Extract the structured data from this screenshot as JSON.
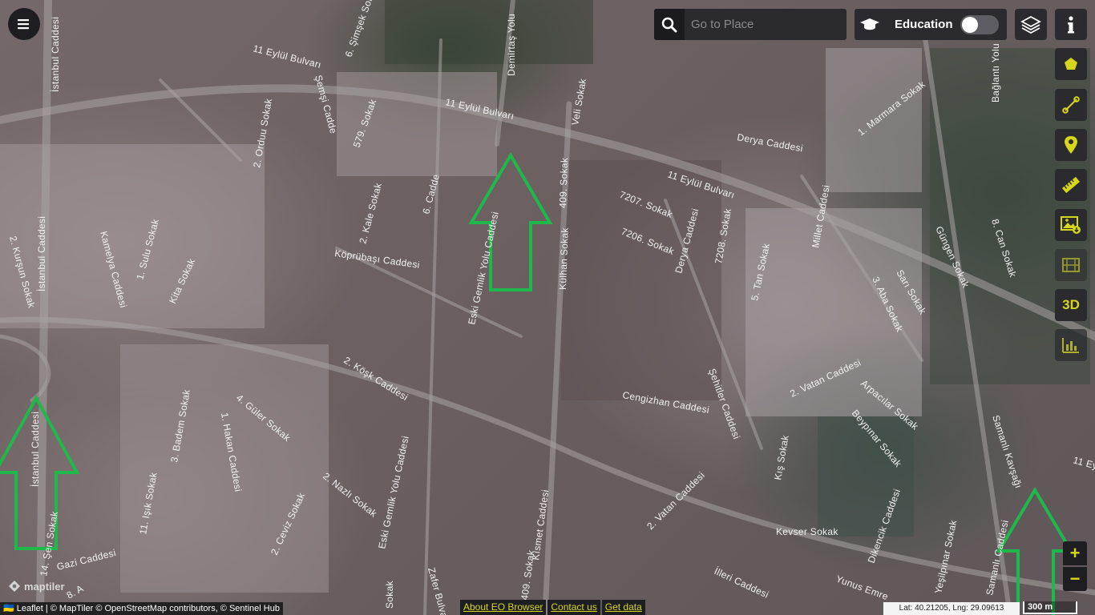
{
  "search": {
    "placeholder": "Go to Place"
  },
  "education": {
    "label": "Education",
    "enabled": false
  },
  "side_buttons": [
    {
      "icon": "polygon-icon"
    },
    {
      "icon": "line-measure-icon"
    },
    {
      "icon": "map-pin-icon"
    },
    {
      "icon": "ruler-icon"
    },
    {
      "icon": "image-download-icon"
    },
    {
      "icon": "film-icon"
    },
    {
      "icon": "3d-label",
      "label": "3D"
    },
    {
      "icon": "bar-chart-icon"
    }
  ],
  "zoom": {
    "in": "+",
    "out": "−"
  },
  "logo": {
    "text": "maptiler"
  },
  "attribution": "🇺🇦 Leaflet | © MapTiler © OpenStreetMap contributors, © Sentinel Hub",
  "footer_links": [
    "About EO Browser",
    "Contact us",
    "Get data"
  ],
  "coords": "Lat: 40.21205, Lng: 29.09613",
  "scale": "300 m",
  "road_labels": [
    {
      "text": "İstanbul Caddesi"
    },
    {
      "text": "11 Eylül Bulvarı"
    },
    {
      "text": "6. Şimşek Sokak"
    },
    {
      "text": "Demirtaş Yolu"
    },
    {
      "text": "Veli Sokak"
    },
    {
      "text": "11 Eylül Bulvarı"
    },
    {
      "text": "11 Eylül Bulvarı"
    },
    {
      "text": "Derya Caddesi"
    },
    {
      "text": "1. Marmara Sokak"
    },
    {
      "text": "Bağlantı Yolu"
    },
    {
      "text": "2. Orduu Sokak"
    },
    {
      "text": "Şemşi Cadde"
    },
    {
      "text": "579. Sokak"
    },
    {
      "text": "7207. Sokak"
    },
    {
      "text": "7206. Sokak"
    },
    {
      "text": "7208. Sokak"
    },
    {
      "text": "Derya Caddesi"
    },
    {
      "text": "Millet Caddesi"
    },
    {
      "text": "Güngen Sokak"
    },
    {
      "text": "8. Can Sokak"
    },
    {
      "text": "İstanbul Caddesi"
    },
    {
      "text": "2. Kurşun Sokak"
    },
    {
      "text": "Kamelya Caddesi"
    },
    {
      "text": "1. Sulu Sokak"
    },
    {
      "text": "Kita Sokak"
    },
    {
      "text": "2. Kale Sokak"
    },
    {
      "text": "6. Cadde"
    },
    {
      "text": "Köprübaşı Caddesi"
    },
    {
      "text": "Eski Gemlik Yolu Caddesi"
    },
    {
      "text": "409. Sokak"
    },
    {
      "text": "Külhan Sokak"
    },
    {
      "text": "5. Tan Sokak"
    },
    {
      "text": "3. Aba Sokak"
    },
    {
      "text": "Sarı Sokak"
    },
    {
      "text": "2. Köşk Caddesi"
    },
    {
      "text": "Cengizhan Caddesi"
    },
    {
      "text": "Şehitler Caddesi"
    },
    {
      "text": "2. Vatan Caddesi"
    },
    {
      "text": "Arpacılar Sokak"
    },
    {
      "text": "Beypınar Sokak"
    },
    {
      "text": "Samanlı Kavşağı"
    },
    {
      "text": "İstanbul Caddesi"
    },
    {
      "text": "3. Badem Sokak"
    },
    {
      "text": "4. Güler Sokak"
    },
    {
      "text": "1. Hakan Caddesi"
    },
    {
      "text": "Kış Sokak"
    },
    {
      "text": "11. Işık Sokak"
    },
    {
      "text": "2. Nazlı Sokak"
    },
    {
      "text": "Eski Gemlik Yolu Caddesi"
    },
    {
      "text": "Kısmet Caddesi"
    },
    {
      "text": "2. Vatan Caddesi"
    },
    {
      "text": "Dikencik Caddesi"
    },
    {
      "text": "Kevser Sokak"
    },
    {
      "text": "14. Şen Sokak"
    },
    {
      "text": "Gazi Caddesi"
    },
    {
      "text": "2. Ceviz Sokak"
    },
    {
      "text": "409. Sokak"
    },
    {
      "text": "Zafer Bulvarı"
    },
    {
      "text": "İlleri Caddesi"
    },
    {
      "text": "Yunus Emre"
    },
    {
      "text": "Yeşilpınar Sokak"
    },
    {
      "text": "Samanlı Caddesi"
    },
    {
      "text": "11 Ey"
    },
    {
      "text": "Sokak"
    },
    {
      "text": "8. A"
    }
  ],
  "annotation_color": "#1fb84a"
}
